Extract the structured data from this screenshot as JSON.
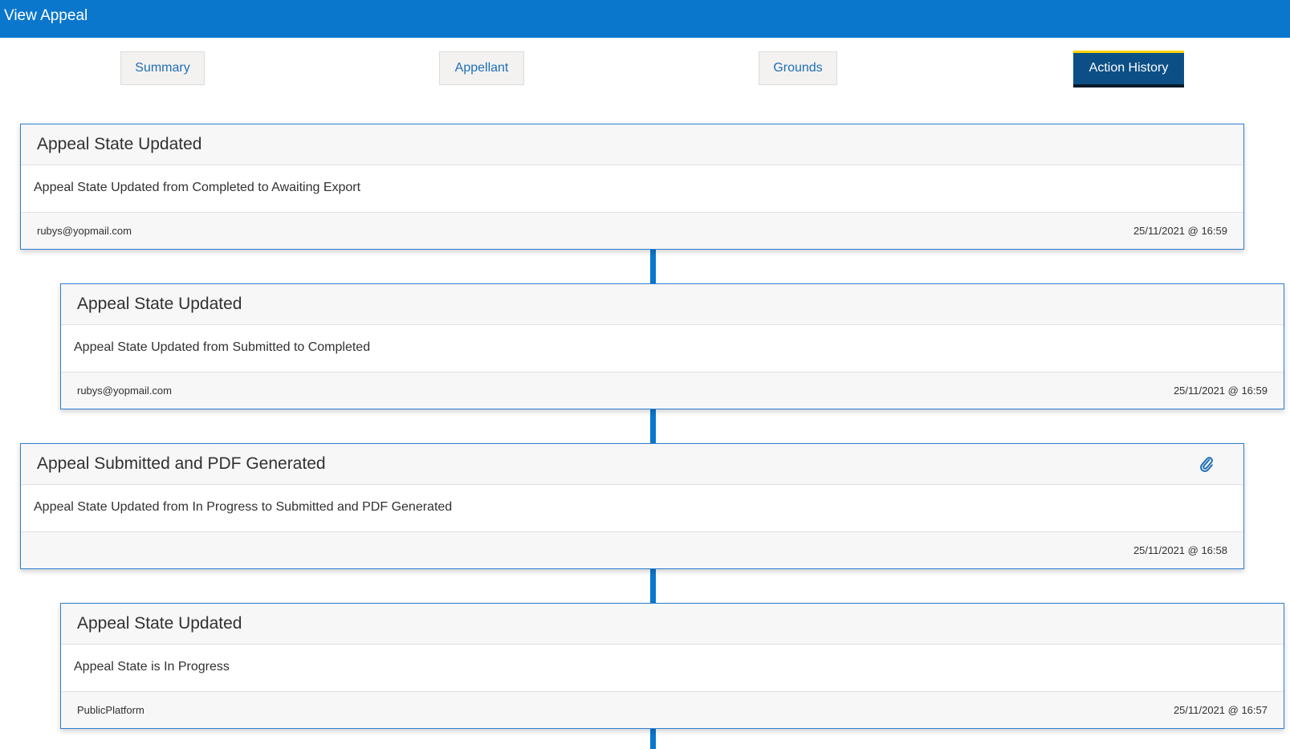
{
  "header": {
    "title": "View Appeal"
  },
  "tabs": [
    {
      "label": "Summary"
    },
    {
      "label": "Appellant"
    },
    {
      "label": "Grounds"
    },
    {
      "label": "Action History",
      "active": true
    }
  ],
  "history": [
    {
      "title": "Appeal State Updated",
      "description": "Appeal State Updated from Completed to Awaiting Export",
      "user": "rubys@yopmail.com",
      "timestamp": "25/11/2021 @ 16:59"
    },
    {
      "title": "Appeal State Updated",
      "description": "Appeal State Updated from Submitted to Completed",
      "user": "rubys@yopmail.com",
      "timestamp": "25/11/2021 @ 16:59"
    },
    {
      "title": "Appeal Submitted and PDF Generated",
      "description": "Appeal State Updated from In Progress to Submitted and PDF Generated",
      "user": "",
      "timestamp": "25/11/2021 @ 16:58",
      "icon": "paperclip-icon"
    },
    {
      "title": "Appeal State Updated",
      "description": "Appeal State is In Progress",
      "user": "PublicPlatform",
      "timestamp": "25/11/2021 @ 16:57"
    }
  ],
  "colors": {
    "header": "#0a77cc",
    "active_tab": "#0b4f86",
    "active_tab_accent": "#ffd200",
    "card_border": "#2e7fd0",
    "link": "#1f6fb6"
  }
}
